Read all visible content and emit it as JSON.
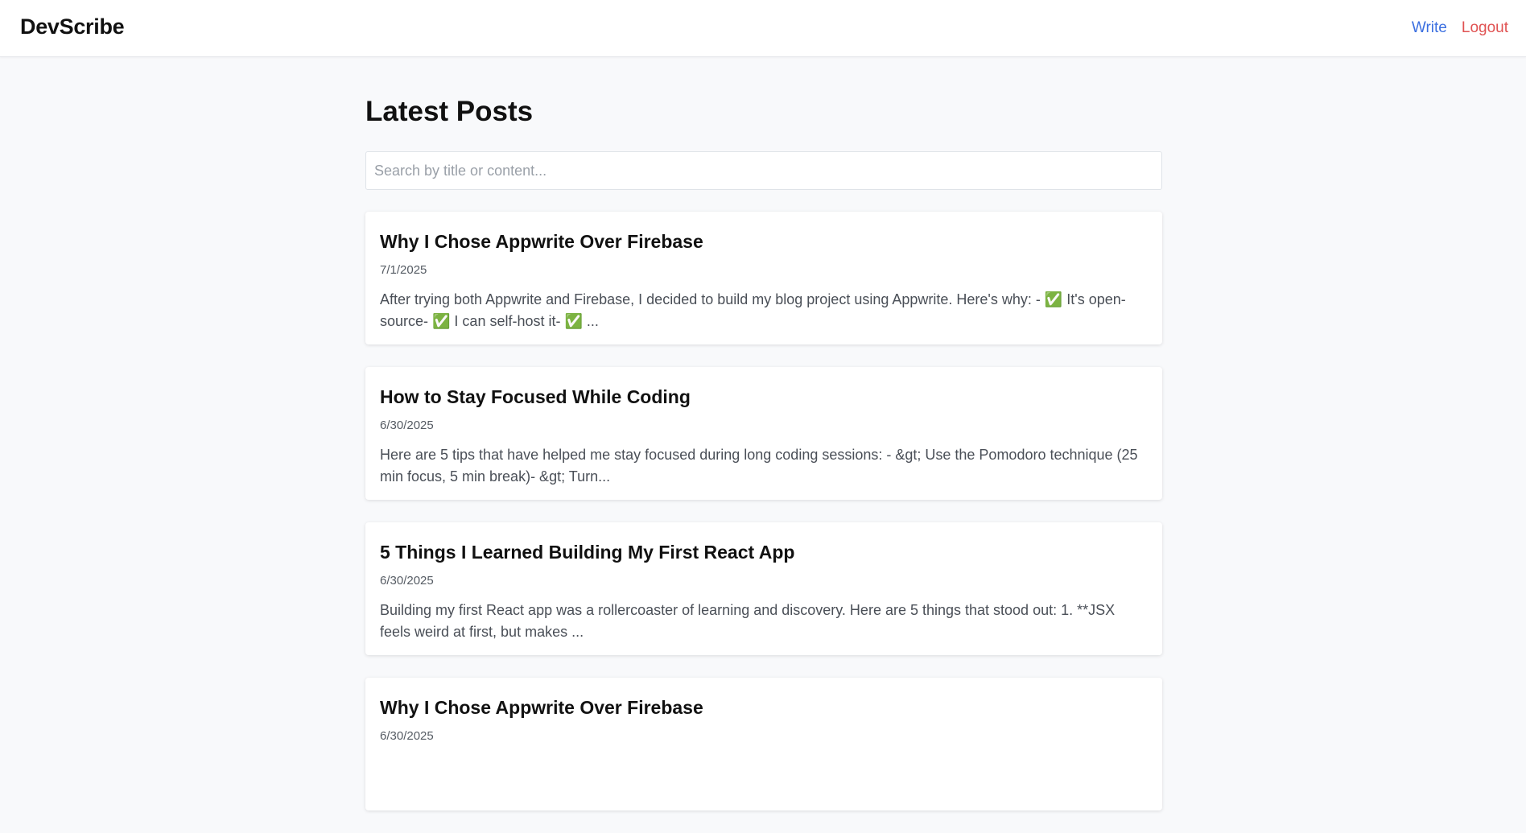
{
  "header": {
    "brand": "DevScribe",
    "nav": {
      "write": "Write",
      "logout": "Logout"
    }
  },
  "main": {
    "title": "Latest Posts",
    "search": {
      "placeholder": "Search by title or content...",
      "value": ""
    },
    "posts": [
      {
        "title": "Why I Chose Appwrite Over Firebase",
        "date": "7/1/2025",
        "excerpt": "After trying both Appwrite and Firebase, I decided to build my blog project using Appwrite. Here's why: - ✅ It's open-source- ✅ I can self-host it- ✅ ..."
      },
      {
        "title": "How to Stay Focused While Coding",
        "date": "6/30/2025",
        "excerpt": "Here are 5 tips that have helped me stay focused during long coding sessions: - &gt; Use the Pomodoro technique (25 min focus, 5 min break)- &gt; Turn..."
      },
      {
        "title": "5 Things I Learned Building My First React App",
        "date": "6/30/2025",
        "excerpt": "Building my first React app was a rollercoaster of learning and discovery. Here are 5 things that stood out: 1. **JSX feels weird at first, but makes ..."
      },
      {
        "title": "Why I Chose Appwrite Over Firebase",
        "date": "6/30/2025",
        "excerpt": ""
      }
    ]
  },
  "colors": {
    "background": "#f8f9fb",
    "write_link": "#3b6fe0",
    "logout_link": "#e05252",
    "text_primary": "#111111"
  }
}
